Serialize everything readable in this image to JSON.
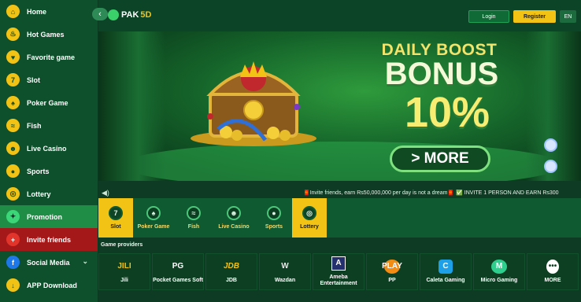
{
  "sidebar": {
    "items": [
      {
        "label": "Home",
        "icon": "home-icon"
      },
      {
        "label": "Hot Games",
        "icon": "flame-icon"
      },
      {
        "label": "Favorite game",
        "icon": "heart-icon"
      },
      {
        "label": "Slot",
        "icon": "slot-icon"
      },
      {
        "label": "Poker Game",
        "icon": "poker-icon"
      },
      {
        "label": "Fish",
        "icon": "fish-icon"
      },
      {
        "label": "Live Casino",
        "icon": "dealer-icon"
      },
      {
        "label": "Sports",
        "icon": "ball-icon"
      },
      {
        "label": "Lottery",
        "icon": "lottery-icon"
      },
      {
        "label": "Promotion",
        "icon": "gift-icon"
      },
      {
        "label": "Invite friends",
        "icon": "invite-icon"
      },
      {
        "label": "Social Media",
        "icon": "facebook-icon"
      },
      {
        "label": "APP Download",
        "icon": "download-icon"
      }
    ]
  },
  "header": {
    "logo_text": "PAK",
    "logo_number": "5D",
    "login": "Login",
    "register": "Register",
    "language": "EN"
  },
  "banner": {
    "line1": "DAILY BOOST",
    "line2": "BONUS",
    "line3": "10%",
    "button": "> MORE"
  },
  "marquee": {
    "text": "🧧Invite friends, earn Rs50,000,000 per day is not a dream🧧 ✅ INVITE 1 PERSON AND EARN Rs300"
  },
  "tabs": [
    {
      "label": "Slot",
      "active": true
    },
    {
      "label": "Poker Game",
      "active": false
    },
    {
      "label": "Fish",
      "active": false
    },
    {
      "label": "Live Casino",
      "active": false
    },
    {
      "label": "Sports",
      "active": false
    },
    {
      "label": "Lottery",
      "active": true
    }
  ],
  "providers": {
    "title": "Game providers",
    "items": [
      {
        "name": "Jili",
        "logo": "JILI"
      },
      {
        "name": "Pocket Games Soft",
        "logo": "PG"
      },
      {
        "name": "JDB",
        "logo": "JDB"
      },
      {
        "name": "Wazdan",
        "logo": "W"
      },
      {
        "name": "Ameba Entertainment",
        "logo": "A"
      },
      {
        "name": "PP",
        "logo": "PLAY"
      },
      {
        "name": "Caleta Gaming",
        "logo": "C"
      },
      {
        "name": "Micro Gaming",
        "logo": "M"
      },
      {
        "name": "MORE",
        "logo": "•••"
      }
    ]
  },
  "colors": {
    "accent_yellow": "#f2c315",
    "brand_green": "#0e4f2c",
    "promotion_green": "#1f8d45",
    "invite_red": "#a5181a"
  }
}
